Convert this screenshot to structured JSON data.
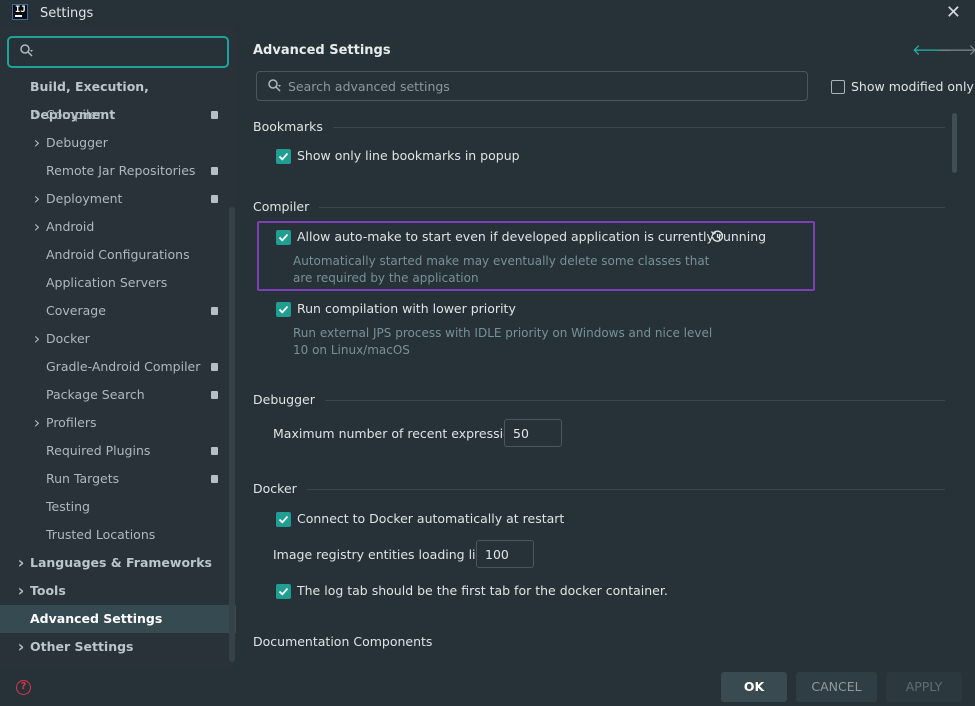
{
  "window": {
    "title": "Settings",
    "close_label": "✕",
    "logo_text": "IJ"
  },
  "sidebar": {
    "search_value": "",
    "items": [
      {
        "label": "Build, Execution, Deployment",
        "level": 0,
        "expandable": false,
        "badge": false
      },
      {
        "label": "Compiler",
        "level": 1,
        "expandable": true,
        "badge": true
      },
      {
        "label": "Debugger",
        "level": 1,
        "expandable": true,
        "badge": false
      },
      {
        "label": "Remote Jar Repositories",
        "level": 1,
        "expandable": false,
        "badge": true
      },
      {
        "label": "Deployment",
        "level": 1,
        "expandable": true,
        "badge": true
      },
      {
        "label": "Android",
        "level": 1,
        "expandable": true,
        "badge": false
      },
      {
        "label": "Android Configurations",
        "level": 1,
        "expandable": false,
        "badge": false
      },
      {
        "label": "Application Servers",
        "level": 1,
        "expandable": false,
        "badge": false
      },
      {
        "label": "Coverage",
        "level": 1,
        "expandable": false,
        "badge": true
      },
      {
        "label": "Docker",
        "level": 1,
        "expandable": true,
        "badge": false
      },
      {
        "label": "Gradle-Android Compiler",
        "level": 1,
        "expandable": false,
        "badge": true
      },
      {
        "label": "Package Search",
        "level": 1,
        "expandable": false,
        "badge": true
      },
      {
        "label": "Profilers",
        "level": 1,
        "expandable": true,
        "badge": false
      },
      {
        "label": "Required Plugins",
        "level": 1,
        "expandable": false,
        "badge": true
      },
      {
        "label": "Run Targets",
        "level": 1,
        "expandable": false,
        "badge": true
      },
      {
        "label": "Testing",
        "level": 1,
        "expandable": false,
        "badge": false
      },
      {
        "label": "Trusted Locations",
        "level": 1,
        "expandable": false,
        "badge": false
      },
      {
        "label": "Languages & Frameworks",
        "level": 0,
        "expandable": true,
        "badge": false
      },
      {
        "label": "Tools",
        "level": 0,
        "expandable": true,
        "badge": false
      },
      {
        "label": "Advanced Settings",
        "level": 0,
        "expandable": false,
        "badge": false,
        "selected": true
      },
      {
        "label": "Other Settings",
        "level": 0,
        "expandable": true,
        "badge": false
      }
    ],
    "help_label": "?"
  },
  "main": {
    "title": "Advanced Settings",
    "search_placeholder": "Search advanced settings",
    "show_modified_label": "Show modified only",
    "show_modified_checked": false,
    "sections": {
      "bookmarks": {
        "title": "Bookmarks",
        "line_bookmarks_label": "Show only line bookmarks in popup",
        "line_bookmarks_checked": true
      },
      "compiler": {
        "title": "Compiler",
        "auto_make_label": "Allow auto-make to start even if developed application is currently running",
        "auto_make_checked": true,
        "auto_make_hint_1": "Automatically started make may eventually delete some classes that",
        "auto_make_hint_2": "are required by the application",
        "low_priority_label": "Run compilation with lower priority",
        "low_priority_checked": true,
        "low_priority_hint_1": "Run external JPS process with IDLE priority on Windows and nice level",
        "low_priority_hint_2": "10 on Linux/macOS"
      },
      "debugger": {
        "title": "Debugger",
        "max_expr_label": "Maximum number of recent expressions:",
        "max_expr_value": "50"
      },
      "docker": {
        "title": "Docker",
        "auto_connect_label": "Connect to Docker automatically at restart",
        "auto_connect_checked": true,
        "registry_limit_label": "Image registry entities loading limit:",
        "registry_limit_value": "100",
        "log_tab_label": "The log tab should be the first tab for the docker container.",
        "log_tab_checked": true
      },
      "documentation": {
        "title": "Documentation Components"
      }
    }
  },
  "buttons": {
    "ok": "OK",
    "cancel": "CANCEL",
    "apply": "APPLY"
  },
  "colors": {
    "accent": "#1fa398",
    "highlight": "#7c3fb8",
    "background": "#263238",
    "selected": "#364a52"
  }
}
